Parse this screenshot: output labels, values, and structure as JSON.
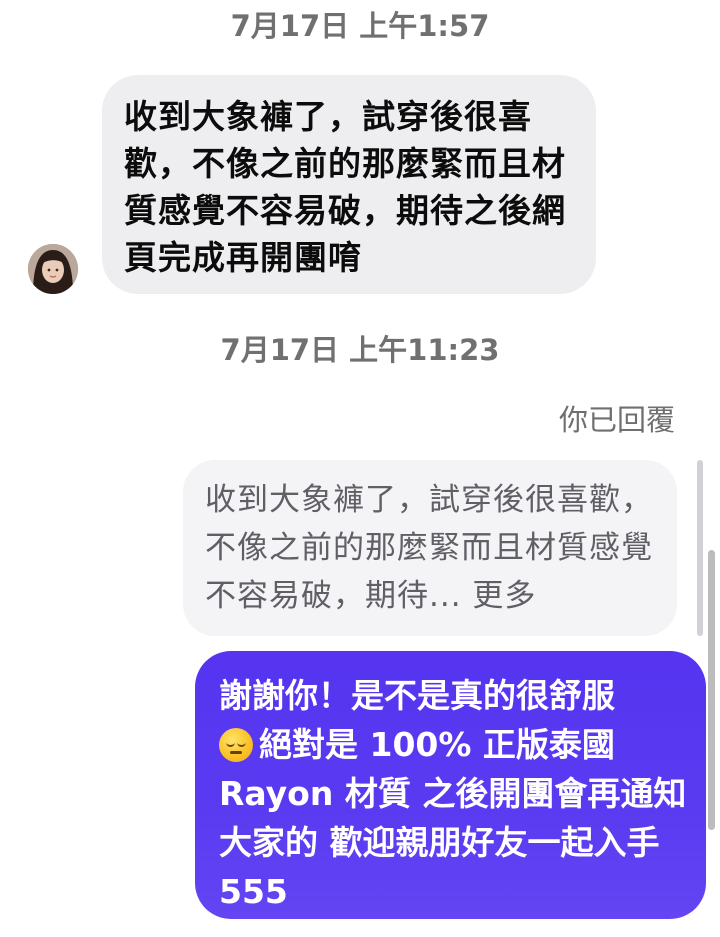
{
  "conversation": {
    "timestamp_1": "7月17日 上午1:57",
    "timestamp_2": "7月17日 上午11:23",
    "incoming_message": {
      "text": "收到大象褲了，試穿後很喜歡，不像之前的那麼緊而且材質感覺不容易破，期待之後網頁完成再開團唷",
      "avatar_icon": "user-avatar"
    },
    "reply_label": "你已回覆",
    "quoted_message": {
      "text": "收到大象褲了，試穿後很喜歡，不像之前的那麼緊而且材質感覺不容易破，期待",
      "more_label": "... 更多"
    },
    "outgoing_message": {
      "text_before_emoji": "謝謝你！是不是真的很舒服",
      "emoji_icon": "relieved-face-emoji",
      "text_after_emoji": "絕對是 100% 正版泰國 Rayon 材質 之後開團會再通知大家的 歡迎親朋好友一起入手 555"
    }
  },
  "colors": {
    "incoming_bubble": "#eeeef1",
    "outgoing_bubble": "#5634f0",
    "timestamp_text": "#707070"
  }
}
